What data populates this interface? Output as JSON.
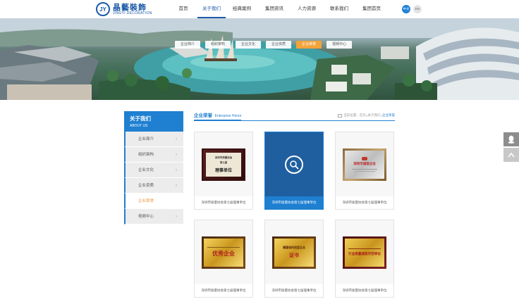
{
  "brand": {
    "mark": "JY",
    "name_cn": "晶藝裝飾",
    "name_en": "JINGYI DECORATION",
    "color": "#1c5aa8"
  },
  "nav": {
    "items": [
      {
        "label": "首页"
      },
      {
        "label": "关于我们",
        "active": true
      },
      {
        "label": "经典案例"
      },
      {
        "label": "集团资讯"
      },
      {
        "label": "人力资源"
      },
      {
        "label": "联系我们"
      },
      {
        "label": "集团首页"
      }
    ],
    "lang_cn": "中文",
    "lang_en": "EN"
  },
  "subnav": {
    "items": [
      {
        "label": "企业简介"
      },
      {
        "label": "组织架构"
      },
      {
        "label": "企业文化"
      },
      {
        "label": "企业资质"
      },
      {
        "label": "企业荣誉",
        "active": true
      },
      {
        "label": "视频中心"
      }
    ]
  },
  "sidebar": {
    "title": "关于我们",
    "subtitle": "ABOUT US",
    "items": [
      {
        "label": "企业简介"
      },
      {
        "label": "组织架构"
      },
      {
        "label": "企业文化"
      },
      {
        "label": "企业资质"
      },
      {
        "label": "企业荣誉",
        "active": true
      },
      {
        "label": "视频中心"
      }
    ]
  },
  "content": {
    "title_cn": "企业荣誉",
    "title_en": "Enterprise Honor",
    "breadcrumb": {
      "prefix": "当前位置：",
      "home": "首页",
      "sep": " > ",
      "parent": "关于我们",
      "current": "企业荣誉"
    }
  },
  "cards": [
    {
      "caption": "深圳市质量协会第七届理事单位",
      "plaque": "dark",
      "plaque_line1": "深圳市质量协会",
      "plaque_line2": "第七届",
      "plaque_text": "理事单位"
    },
    {
      "caption": "深圳市质量协会第七届理事单位",
      "plaque": "hover"
    },
    {
      "caption": "深圳市质量协会第七届理事单位",
      "plaque": "silver",
      "plaque_text": "深圳市诚信企业"
    },
    {
      "caption": "深圳市质量协会第七届理事单位",
      "plaque": "gold",
      "plaque_text": "优秀企业"
    },
    {
      "caption": "深圳市质量协会第七届理事单位",
      "plaque": "gold",
      "plaque_line1": "福建省科技型企业",
      "plaque_text": "证书"
    },
    {
      "caption": "深圳市质量协会第七届理事单位",
      "plaque": "gold-red",
      "plaque_text": "行业质量诚信示范单位"
    }
  ],
  "colors": {
    "primary": "#1f7fd1",
    "accent": "#f2a33a",
    "active_text": "#e7953a"
  }
}
